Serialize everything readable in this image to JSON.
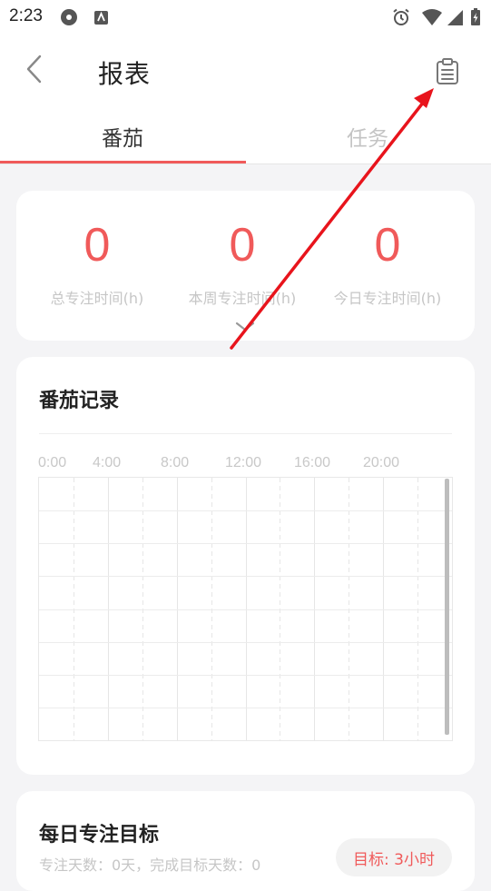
{
  "status_bar": {
    "time": "2:23"
  },
  "header": {
    "title": "报表"
  },
  "tabs": [
    {
      "label": "番茄",
      "active": true
    },
    {
      "label": "任务",
      "active": false
    }
  ],
  "stats": [
    {
      "value": "0",
      "label": "总专注时间(h)"
    },
    {
      "value": "0",
      "label": "本周专注时间(h)"
    },
    {
      "value": "0",
      "label": "今日专注时间(h)"
    }
  ],
  "records": {
    "title": "番茄记录",
    "hours": [
      "0:00",
      "4:00",
      "8:00",
      "12:00",
      "16:00",
      "20:00"
    ]
  },
  "goal": {
    "title": "每日专注目标",
    "summary": "专注天数：0天，完成目标天数：0",
    "target": "目标: 3小时"
  },
  "colors": {
    "accent": "#f05a5a",
    "background": "#f4f4f6",
    "card": "#ffffff",
    "annotation_arrow": "#e8141c"
  }
}
